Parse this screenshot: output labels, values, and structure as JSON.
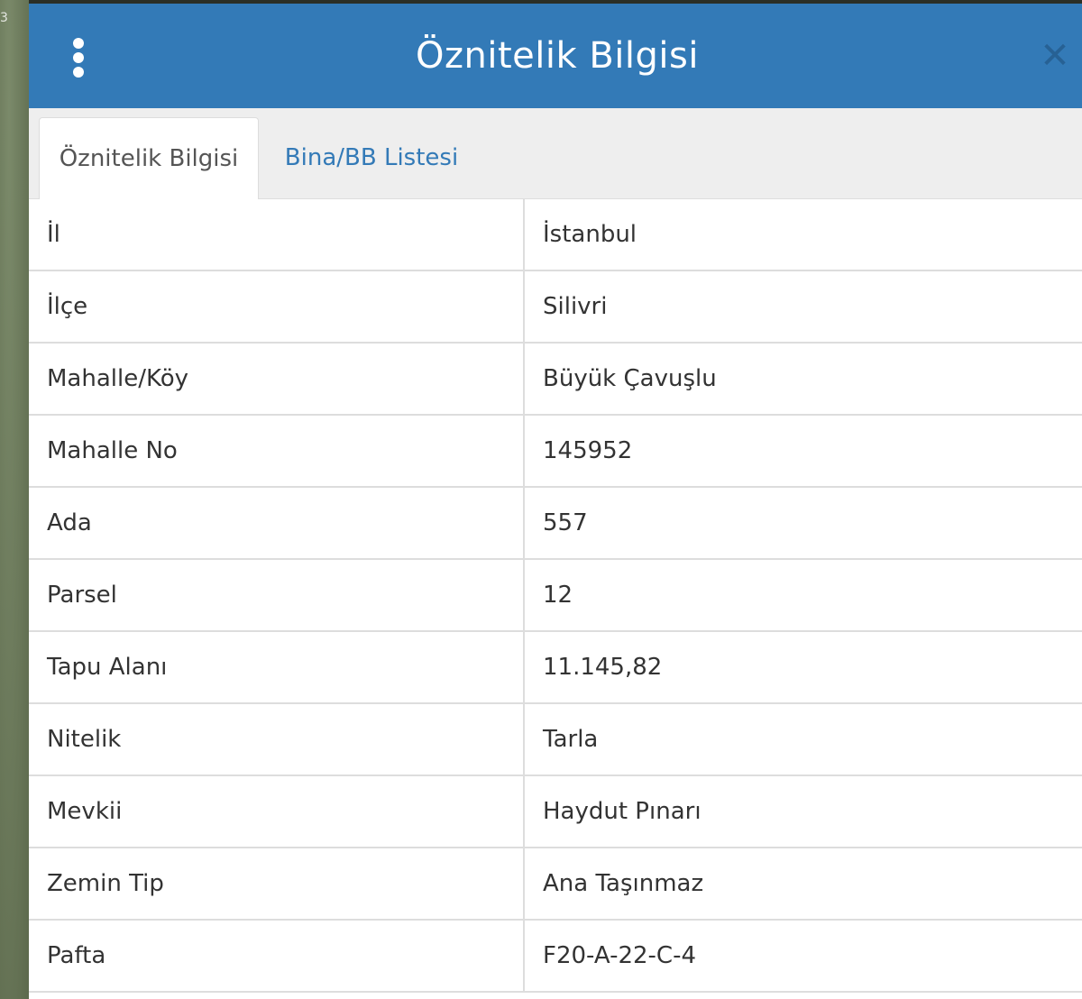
{
  "background": {
    "map_label": "3"
  },
  "header": {
    "title": "Öznitelik Bilgisi",
    "menu_icon": "kebab-menu-icon",
    "close_icon": "close-icon",
    "accent_color": "#337ab7"
  },
  "tabs": [
    {
      "label": "Öznitelik Bilgisi",
      "active": true
    },
    {
      "label": "Bina/BB Listesi",
      "active": false
    }
  ],
  "attributes": [
    {
      "label": "İl",
      "value": "İstanbul"
    },
    {
      "label": "İlçe",
      "value": "Silivri"
    },
    {
      "label": "Mahalle/Köy",
      "value": "Büyük Çavuşlu"
    },
    {
      "label": "Mahalle No",
      "value": "145952"
    },
    {
      "label": "Ada",
      "value": "557"
    },
    {
      "label": "Parsel",
      "value": "12"
    },
    {
      "label": "Tapu Alanı",
      "value": "11.145,82"
    },
    {
      "label": "Nitelik",
      "value": "Tarla"
    },
    {
      "label": "Mevkii",
      "value": "Haydut Pınarı"
    },
    {
      "label": "Zemin Tip",
      "value": "Ana Taşınmaz"
    },
    {
      "label": "Pafta",
      "value": "F20-A-22-C-4"
    }
  ]
}
